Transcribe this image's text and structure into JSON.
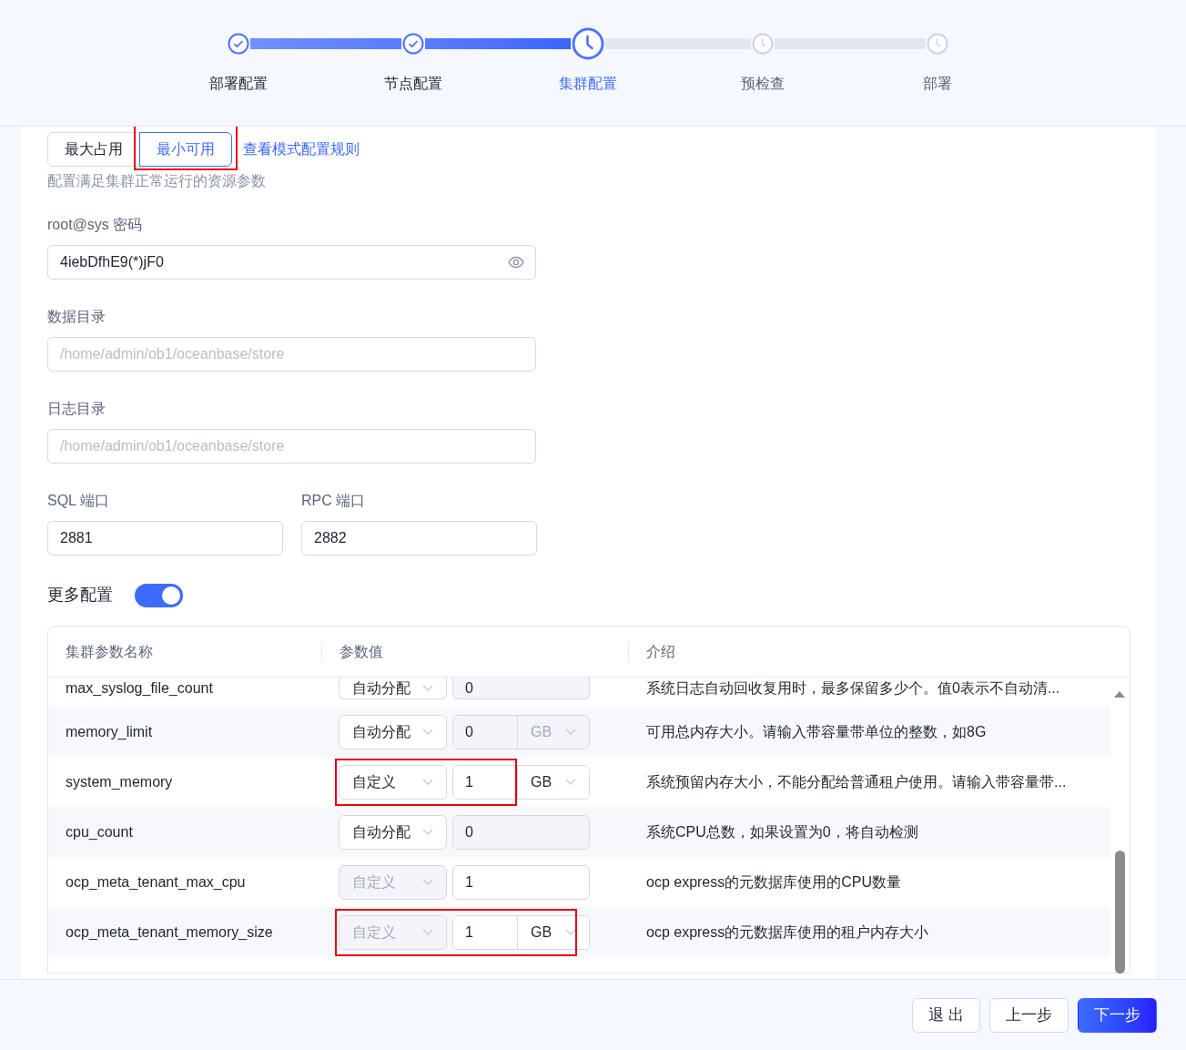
{
  "steps": [
    {
      "label": "部署配置",
      "done": true,
      "active": false
    },
    {
      "label": "节点配置",
      "done": true,
      "active": false
    },
    {
      "label": "集群配置",
      "done": false,
      "active": true
    },
    {
      "label": "预检查",
      "done": false,
      "active": false
    },
    {
      "label": "部署",
      "done": false,
      "active": false
    }
  ],
  "modes": [
    {
      "label": "最大占用",
      "selected": false,
      "highlighted": false
    },
    {
      "label": "最小可用",
      "selected": true,
      "highlighted": true
    }
  ],
  "mode_rules_link": "查看模式配置规则",
  "mode_description": "配置满足集群正常运行的资源参数",
  "password": {
    "label": "root@sys 密码",
    "value": "4iebDfhE9(*)jF0"
  },
  "data_dir": {
    "label": "数据目录",
    "placeholder": "/home/admin/ob1/oceanbase/store"
  },
  "log_dir": {
    "label": "日志目录",
    "placeholder": "/home/admin/ob1/oceanbase/store"
  },
  "sql_port": {
    "label": "SQL 端口",
    "value": "2881"
  },
  "rpc_port": {
    "label": "RPC 端口",
    "value": "2882"
  },
  "more_config": {
    "label": "更多配置",
    "on": true
  },
  "table": {
    "columns": [
      "集群参数名称",
      "参数值",
      "介绍"
    ],
    "rows": [
      {
        "name": "max_syslog_file_count",
        "mode": {
          "label": "自动分配",
          "disabled": false
        },
        "value": {
          "text": "0",
          "disabled": true
        },
        "intro": "系统日志自动回收复用时，最多保留多少个。值0表示不自动清...",
        "highlighted": false
      },
      {
        "name": "memory_limit",
        "mode": {
          "label": "自动分配",
          "disabled": false
        },
        "value": {
          "text": "0",
          "disabled": true
        },
        "unit": {
          "label": "GB",
          "disabled": true,
          "highlighted": false
        },
        "intro": "可用总内存大小。请输入带容量带单位的整数，如8G",
        "highlighted": false
      },
      {
        "name": "system_memory",
        "mode": {
          "label": "自定义",
          "disabled": false
        },
        "value": {
          "text": "1",
          "disabled": false
        },
        "unit": {
          "label": "GB",
          "disabled": false,
          "highlighted": false
        },
        "intro": "系统预留内存大小，不能分配给普通租户使用。请输入带容量带...",
        "highlighted": true
      },
      {
        "name": "cpu_count",
        "mode": {
          "label": "自动分配",
          "disabled": false
        },
        "value": {
          "text": "0",
          "disabled": true
        },
        "intro": "系统CPU总数，如果设置为0，将自动检测",
        "highlighted": false
      },
      {
        "name": "ocp_meta_tenant_max_cpu",
        "mode": {
          "label": "自定义",
          "disabled": true
        },
        "value": {
          "text": "1",
          "disabled": false
        },
        "intro": "ocp express的元数据库使用的CPU数量",
        "highlighted": false
      },
      {
        "name": "ocp_meta_tenant_memory_size",
        "mode": {
          "label": "自定义",
          "disabled": true
        },
        "value": {
          "text": "1",
          "disabled": false
        },
        "unit": {
          "label": "GB",
          "disabled": false,
          "highlighted": true
        },
        "intro": "ocp express的元数据库使用的租户内存大小",
        "highlighted": true
      }
    ]
  },
  "buttons": [
    {
      "label": "退 出",
      "kind": "default"
    },
    {
      "label": "上一步",
      "kind": "default"
    },
    {
      "label": "下一步",
      "kind": "primary"
    }
  ]
}
